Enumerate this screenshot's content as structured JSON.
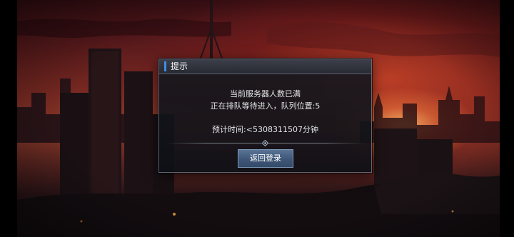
{
  "dialog": {
    "title": "提示",
    "line1": "当前服务器人数已满",
    "line2": "正在排队等待进入，队列位置:5",
    "line3": "预计时间:<5308311507分钟",
    "button_label": "返回登录"
  },
  "colors": {
    "accent": "#3f8fe6",
    "button": "#3e5677",
    "sky": "#8c3a28"
  },
  "icons": [
    "diamond-ornament-icon"
  ]
}
